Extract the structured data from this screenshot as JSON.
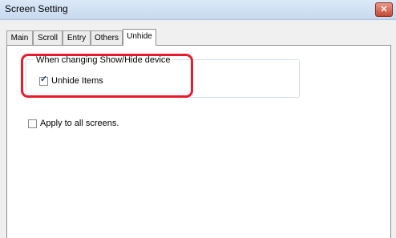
{
  "window": {
    "title": "Screen Setting",
    "close_label": "✕"
  },
  "tabs": [
    {
      "label": "Main"
    },
    {
      "label": "Scroll"
    },
    {
      "label": "Entry"
    },
    {
      "label": "Others"
    },
    {
      "label": "Unhide",
      "active": true
    }
  ],
  "group": {
    "legend": "When changing Show/Hide device",
    "unhide_items": {
      "label": "Unhide Items",
      "checked": true
    }
  },
  "apply_all": {
    "label": "Apply to all screens.",
    "checked": false
  },
  "colors": {
    "highlight": "#e81c2c",
    "title_bar": "#c8daf0"
  }
}
